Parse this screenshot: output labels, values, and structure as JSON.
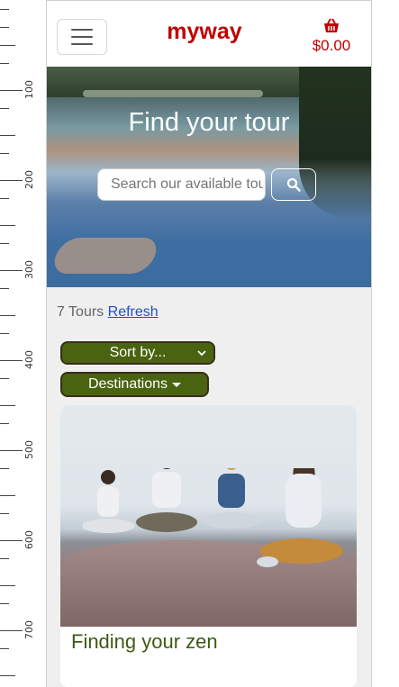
{
  "ruler": {
    "labels": [
      "100",
      "200",
      "300",
      "400",
      "500",
      "600",
      "700"
    ]
  },
  "navbar": {
    "brand": "myway",
    "basket_total": "$0.00",
    "menu_icon": "hamburger-icon",
    "basket_icon": "basket-icon"
  },
  "hero": {
    "title": "Find your tour",
    "search_placeholder": "Search our available tours",
    "search_icon": "search-icon"
  },
  "results": {
    "count_text": "7 Tours",
    "refresh_link": "Refresh"
  },
  "filters": {
    "sort_selected": "Sort by...",
    "destinations_label": "Destinations"
  },
  "tours": [
    {
      "title": "Finding your zen"
    }
  ],
  "colors": {
    "brand": "#c00000",
    "accent_green": "#4a6310",
    "title_green": "#3f5a12",
    "link": "#1f4fcc"
  }
}
